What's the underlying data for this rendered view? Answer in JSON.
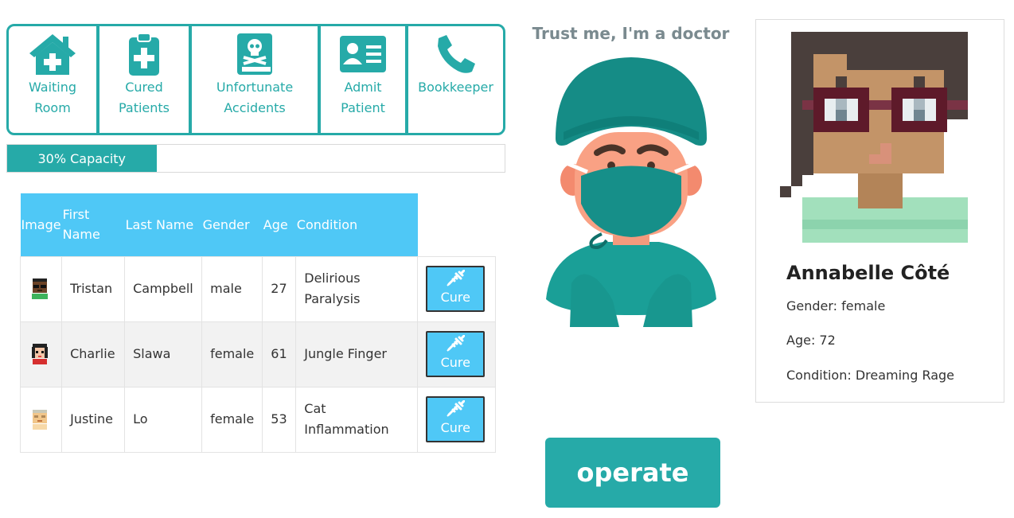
{
  "nav": {
    "items": [
      {
        "label": "Waiting\nRoom",
        "icon": "house-medical-icon"
      },
      {
        "label": "Cured\nPatients",
        "icon": "clipboard-medical-icon"
      },
      {
        "label": "Unfortunate\nAccidents",
        "icon": "skull-book-icon"
      },
      {
        "label": "Admit\nPatient",
        "icon": "id-card-icon"
      },
      {
        "label": "Bookkeeper",
        "icon": "phone-icon"
      }
    ]
  },
  "capacity": {
    "label": "30% Capacity",
    "percent": 30
  },
  "table": {
    "headers": {
      "image": "Image",
      "first": "First\nName",
      "last": "Last Name",
      "gender": "Gender",
      "age": "Age",
      "condition": "Condition"
    },
    "cure_label": "Cure",
    "rows": [
      {
        "first": "Tristan",
        "last": "Campbell",
        "gender": "male",
        "age": "27",
        "condition": "Delirious Paralysis"
      },
      {
        "first": "Charlie",
        "last": "Slawa",
        "gender": "female",
        "age": "61",
        "condition": "Jungle Finger"
      },
      {
        "first": "Justine",
        "last": "Lo",
        "gender": "female",
        "age": "53",
        "condition": "Cat Inflammation"
      }
    ]
  },
  "doctor": {
    "title": "Trust me, I'm a doctor",
    "operate_label": "operate"
  },
  "card": {
    "name": "Annabelle Côté",
    "gender": "Gender: female",
    "age": "Age: 72",
    "condition": "Condition: Dreaming Rage"
  },
  "colors": {
    "teal": "#26aaa8",
    "blue": "#4fc8f6"
  }
}
